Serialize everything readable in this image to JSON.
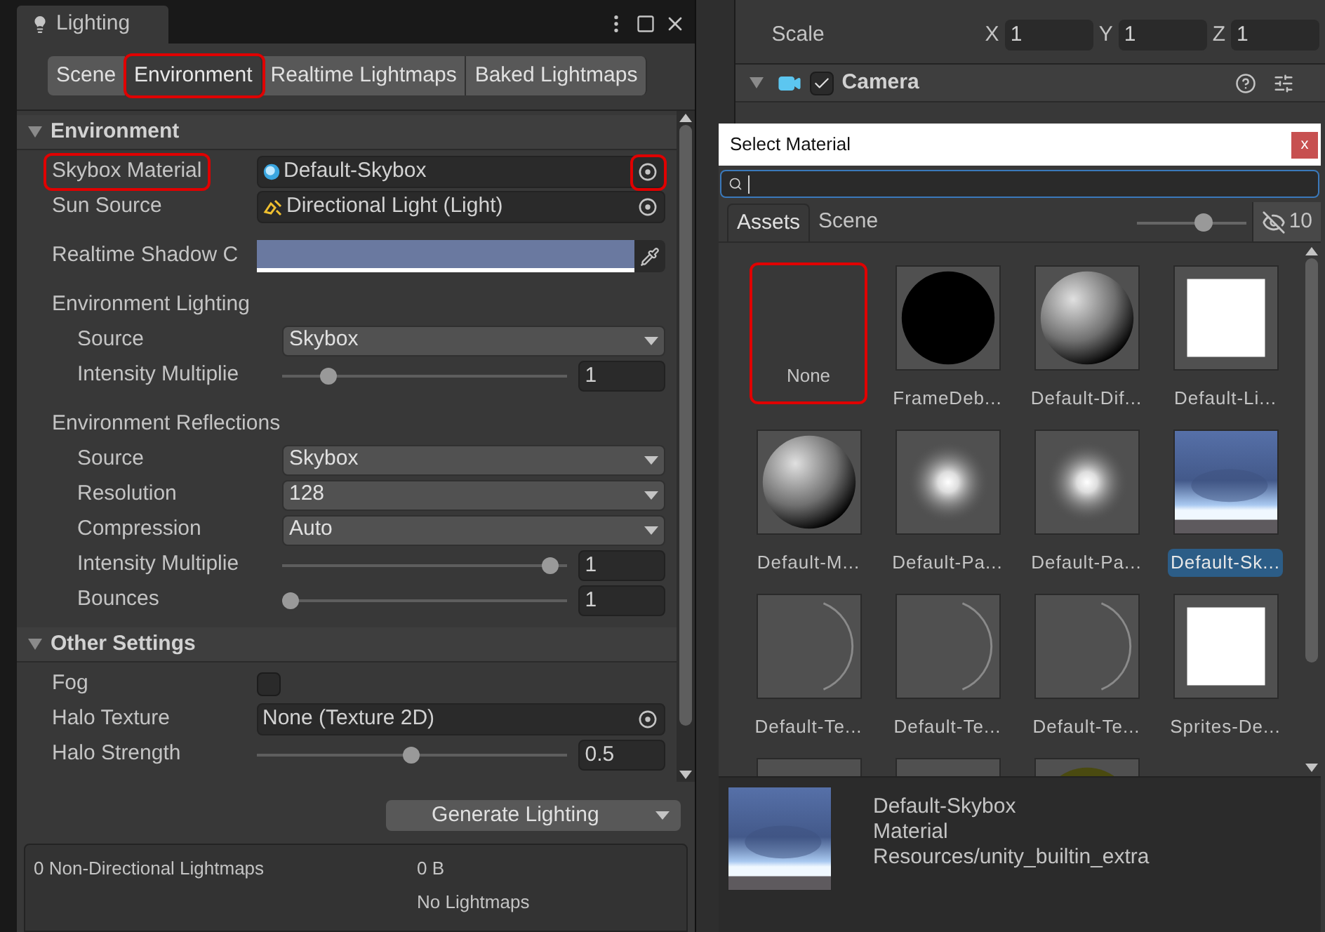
{
  "lighting": {
    "title": "Lighting",
    "tabs": [
      {
        "label": "Scene",
        "selected": false,
        "highlighted": false
      },
      {
        "label": "Environment",
        "selected": true,
        "highlighted": true
      },
      {
        "label": "Realtime Lightmaps",
        "selected": false,
        "highlighted": false
      },
      {
        "label": "Baked Lightmaps",
        "selected": false,
        "highlighted": false
      }
    ],
    "sections": [
      {
        "title": "Environment",
        "expanded": true,
        "rows": [
          {
            "kind": "material",
            "label": "Skybox Material",
            "value": "Default-Skybox",
            "highlighted": true
          },
          {
            "kind": "light",
            "label": "Sun Source",
            "value": "Directional Light (Light)",
            "highlighted": false
          },
          {
            "kind": "color",
            "label": "Realtime Shadow C",
            "color": "#6a79a0"
          },
          {
            "kind": "heading",
            "label": "Environment Lighting"
          },
          {
            "kind": "dropdown",
            "label": "Source",
            "value": "Skybox"
          },
          {
            "kind": "slider",
            "label": "Intensity Multiplie",
            "level": 0.14,
            "reading": "1"
          },
          {
            "kind": "heading",
            "label": "Environment Reflections"
          },
          {
            "kind": "dropdown",
            "label": "Source",
            "value": "Skybox"
          },
          {
            "kind": "dropdown",
            "label": "Resolution",
            "value": "128"
          },
          {
            "kind": "dropdown",
            "label": "Compression",
            "value": "Auto"
          },
          {
            "kind": "slider",
            "label": "Intensity Multiplie",
            "level": 0.97,
            "reading": "1"
          },
          {
            "kind": "slider",
            "label": "Bounces",
            "level": 0.0,
            "reading": "1"
          }
        ]
      },
      {
        "title": "Other Settings",
        "expanded": true,
        "rows": [
          {
            "kind": "checkbox",
            "label": "Fog",
            "checked": false
          },
          {
            "kind": "texture",
            "label": "Halo Texture",
            "value": "None (Texture 2D)",
            "highlighted": false
          },
          {
            "kind": "slider",
            "label": "Halo Strength",
            "level": 0.5,
            "reading": "0.5"
          }
        ]
      }
    ],
    "generate_button": "Generate Lighting",
    "stats": [
      {
        "label": "0 Non-Directional Lightmaps",
        "size": "0 B"
      },
      {
        "size": "No Lightmaps"
      }
    ]
  },
  "inspector": {
    "scale": {
      "label": "Scale",
      "axes": [
        {
          "axis": "X",
          "value": "1"
        },
        {
          "axis": "Y",
          "value": "1"
        },
        {
          "axis": "Z",
          "value": "1"
        }
      ]
    },
    "component": {
      "title": "Camera",
      "expanded": true,
      "enabled": true
    }
  },
  "dialog": {
    "title": "Select Material",
    "close": "x",
    "tabs": [
      {
        "label": "Assets",
        "selected": true
      },
      {
        "label": "Scene",
        "selected": false
      }
    ],
    "zoom": {
      "level": 0.62
    },
    "hidden_count": "10",
    "items": [
      {
        "kind": "none",
        "label": "None",
        "selected": false,
        "highlighted": true
      },
      {
        "kind": "black-sphere",
        "label": "FrameDeb...",
        "selected": false,
        "highlighted": false
      },
      {
        "kind": "sphere",
        "label": "Default-Dif...",
        "selected": false,
        "highlighted": false
      },
      {
        "kind": "white-square",
        "label": "Default-Li...",
        "selected": false,
        "highlighted": false
      },
      {
        "kind": "sphere",
        "label": "Default-M...",
        "selected": false,
        "highlighted": false
      },
      {
        "kind": "glow",
        "label": "Default-Pa...",
        "selected": false,
        "highlighted": false
      },
      {
        "kind": "glow",
        "label": "Default-Pa...",
        "selected": false,
        "highlighted": false
      },
      {
        "kind": "sky",
        "label": "Default-Sk...",
        "selected": true,
        "highlighted": false
      },
      {
        "kind": "crescent",
        "label": "Default-Te...",
        "selected": false,
        "highlighted": false
      },
      {
        "kind": "crescent",
        "label": "Default-Te...",
        "selected": false,
        "highlighted": false
      },
      {
        "kind": "crescent",
        "label": "Default-Te...",
        "selected": false,
        "highlighted": false
      },
      {
        "kind": "white-square",
        "label": "Sprites-De...",
        "selected": false,
        "highlighted": false
      },
      {
        "kind": "blank"
      },
      {
        "kind": "blank"
      },
      {
        "kind": "moss"
      }
    ],
    "preview": {
      "name": "Default-Skybox",
      "type": "Material",
      "path": "Resources/unity_builtin_extra"
    }
  }
}
